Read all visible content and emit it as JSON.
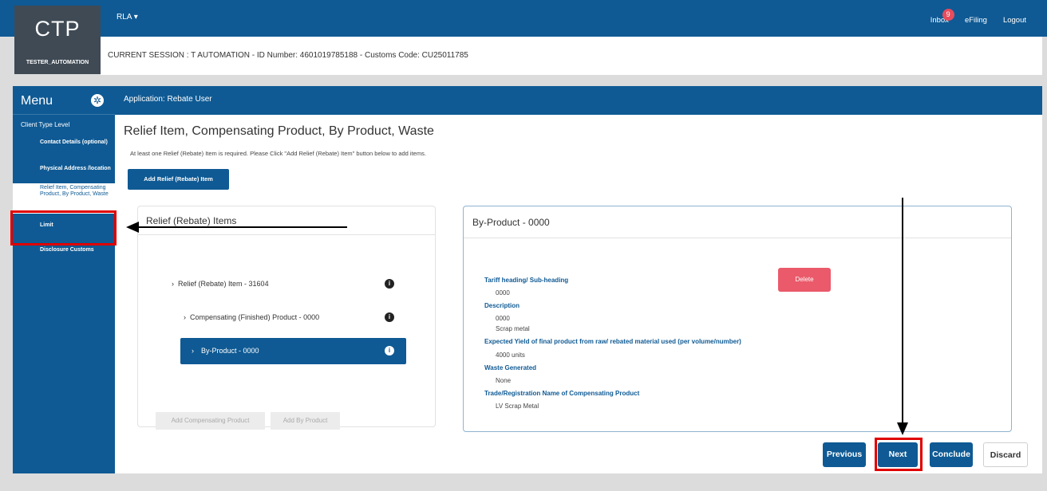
{
  "app": {
    "logo": "CTP",
    "username": "TESTER_AUTOMATION",
    "role_menu": "RLA",
    "top_links": {
      "inbox": "Inbox",
      "inbox_count": "9",
      "efiling": "eFiling",
      "logout": "Logout"
    },
    "session": "CURRENT SESSION : T AUTOMATION - ID Number: 4601019785188 - Customs Code: CU25011785"
  },
  "sidebar": {
    "title": "Menu",
    "level": "Client Type Level",
    "items": [
      {
        "label": "Contact Details (optional)"
      },
      {
        "label": "Physical Address /location"
      },
      {
        "label": "Relief Item, Compensating Product, By Product, Waste"
      },
      {
        "label": "Limit"
      },
      {
        "label": "Disclosure Customs"
      }
    ]
  },
  "main": {
    "header": "Application: Rebate User",
    "title": "Relief Item, Compensating Product, By Product, Waste",
    "hint": "At least one Relief (Rebate) Item is required. Please Click \"Add Relief (Rebate) Item\" button below to add items.",
    "add_button": "Add Relief (Rebate) Item",
    "left_panel": {
      "title": "Relief (Rebate) Items",
      "tree": [
        {
          "label": "Relief (Rebate) Item - 31604"
        },
        {
          "label": "Compensating (Finished) Product - 0000"
        },
        {
          "label": "By-Product - 0000"
        }
      ],
      "add_compensating": "Add Compensating Product",
      "add_by_product": "Add By Product"
    },
    "right_panel": {
      "title": "By-Product - 0000",
      "delete": "Delete",
      "fields": [
        {
          "label": "Tariff heading/ Sub-heading",
          "values": [
            "0000"
          ]
        },
        {
          "label": "Description",
          "values": [
            "0000",
            "Scrap metal"
          ]
        },
        {
          "label": "Expected Yield of final product from raw/ rebated material used (per volume/number)",
          "values": [
            "4000 units"
          ]
        },
        {
          "label": "Waste Generated",
          "values": [
            "None"
          ]
        },
        {
          "label": "Trade/Registration Name of Compensating Product",
          "values": [
            "LV Scrap Metal"
          ]
        }
      ]
    },
    "nav": {
      "previous": "Previous",
      "next": "Next",
      "conclude": "Conclude",
      "discard": "Discard"
    }
  },
  "colors": {
    "brand_blue": "#0f5a94",
    "delete_red": "#ea5a6a",
    "annotation_red": "#e00000"
  }
}
